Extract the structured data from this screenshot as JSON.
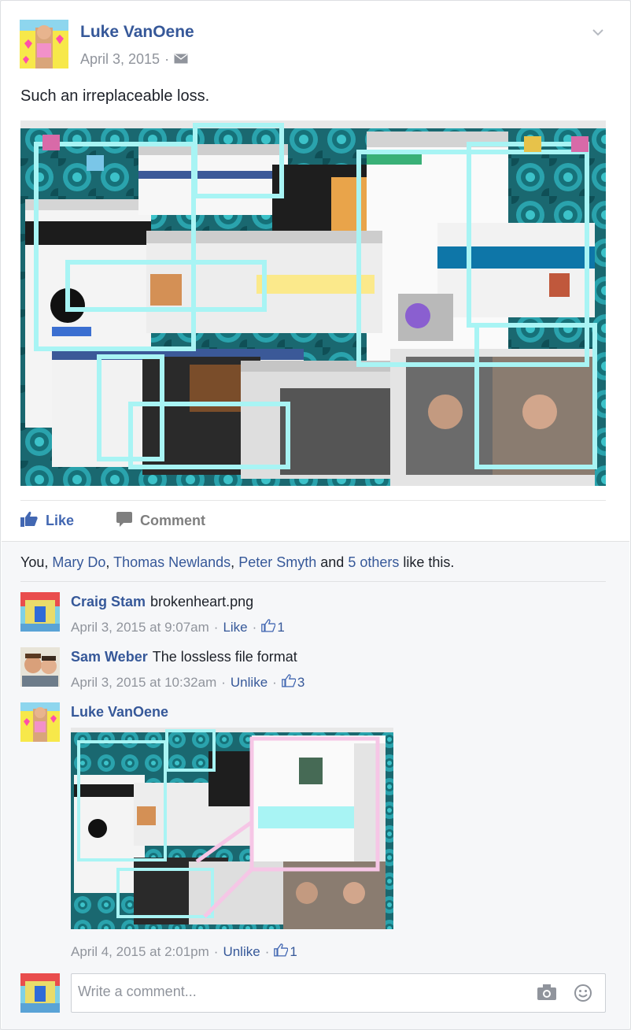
{
  "post": {
    "author": "Luke VanOene",
    "date": "April 3, 2015",
    "separator": "·",
    "text": "Such an irreplaceable loss."
  },
  "actions": {
    "like_label": "Like",
    "comment_label": "Comment"
  },
  "likes": {
    "prefix": "You,",
    "names": [
      "Mary Do",
      "Thomas Newlands",
      "Peter Smyth"
    ],
    "and_label": "and",
    "others": "5 others",
    "suffix": "like this."
  },
  "comments": [
    {
      "author": "Craig Stam",
      "text": "brokenheart.png",
      "timestamp": "April 3, 2015 at 9:07am",
      "action": "Like",
      "reaction_count": "1"
    },
    {
      "author": "Sam Weber",
      "text": "The lossless file format",
      "timestamp": "April 3, 2015 at 10:32am",
      "action": "Unlike",
      "reaction_count": "3"
    },
    {
      "author": "Luke VanOene",
      "text": "",
      "timestamp": "April 4, 2015 at 2:01pm",
      "action": "Unlike",
      "reaction_count": "1"
    }
  ],
  "write_comment": {
    "placeholder": "Write a comment..."
  },
  "icons": {
    "options": "chevron-down-icon",
    "privacy": "envelope-icon",
    "like": "thumbs-up-icon",
    "comment": "speech-bubble-icon",
    "camera": "camera-icon",
    "emoji": "smiley-icon"
  },
  "colors": {
    "link": "#365899",
    "like_blue": "#4267b2",
    "meta_gray": "#90949c",
    "comments_bg": "#f6f7f9",
    "screenshot_bg": "#1d6e77",
    "highlight_cyan": "#a8f4f4",
    "highlight_pink": "#f6c6e6"
  }
}
